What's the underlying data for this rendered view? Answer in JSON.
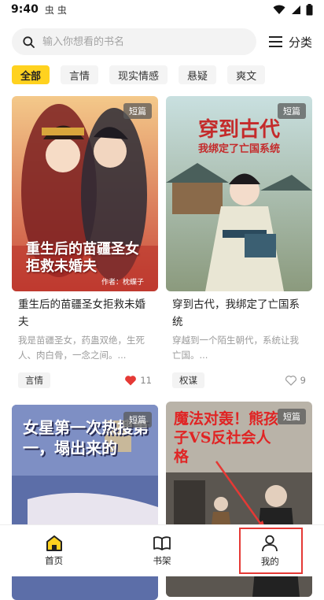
{
  "status": {
    "time": "9:40",
    "notif1": "虫",
    "notif2": "虫"
  },
  "search": {
    "placeholder": "输入你想看的书名",
    "category_label": "分类"
  },
  "tabs": [
    "全部",
    "言情",
    "现实情感",
    "悬疑",
    "爽文"
  ],
  "books": [
    {
      "tag": "短篇",
      "cover_title": "重生后的苗疆圣女拒救未婚夫",
      "cover_author": "作者：枕蝶子",
      "title": "重生后的苗疆圣女拒救未婚夫",
      "desc": "我是苗疆圣女，药蛊双绝，生死人、肉白骨，一念之间。...",
      "genre": "言情",
      "likes": "11",
      "liked": true
    },
    {
      "tag": "短篇",
      "cover_title": "穿到古代",
      "cover_subtitle": "我绑定了亡国系统",
      "title": "穿到古代，我绑定了亡国系统",
      "desc": "穿越到一个陌生朝代，系统让我亡国。...",
      "genre": "权谋",
      "likes": "9",
      "liked": false
    },
    {
      "tag": "短篇",
      "cover_title": "女星第一次热搜第一，塌出来的"
    },
    {
      "tag": "短篇",
      "cover_title": "魔法对轰！熊孩子VS反社会人格"
    }
  ],
  "nav": {
    "home": "首页",
    "shelf": "书架",
    "mine": "我的"
  },
  "colors": {
    "accent": "#ffd21f",
    "heart": "#e53935",
    "highlight": "#e53935"
  }
}
